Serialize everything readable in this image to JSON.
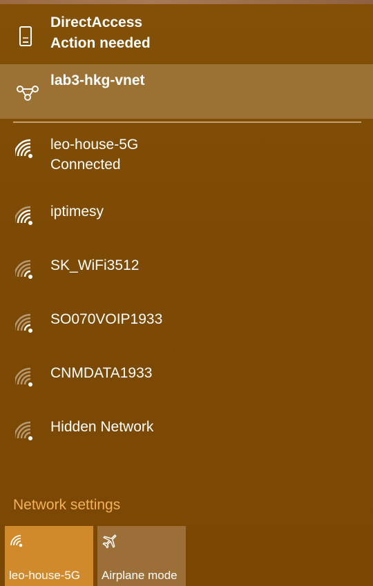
{
  "vpn": {
    "name": "DirectAccess",
    "status": "Action needed",
    "icon": "phone-vpn-icon"
  },
  "dial_up": {
    "name": "lab3-hkg-vnet",
    "icon": "vpn-connection-icon"
  },
  "networks": [
    {
      "name": "leo-house-5G",
      "status": "Connected",
      "icon": "wifi-signal-icon"
    },
    {
      "name": "iptimesy",
      "icon": "wifi-signal-icon"
    },
    {
      "name": "SK_WiFi3512",
      "icon": "wifi-signal-icon"
    },
    {
      "name": "SO070VOIP1933",
      "icon": "wifi-signal-icon"
    },
    {
      "name": "CNMDATA1933",
      "icon": "wifi-signal-icon"
    },
    {
      "name": "Hidden Network",
      "icon": "wifi-signal-icon"
    }
  ],
  "settings_link": "Network settings",
  "quick_actions": [
    {
      "label": "leo-house-5G",
      "icon": "wifi-icon",
      "active": true
    },
    {
      "label": "Airplane mode",
      "icon": "airplane-icon",
      "active": false
    }
  ],
  "colors": {
    "background": "#7f4b05",
    "accent": "#d18a2b",
    "link": "#f3b15a"
  }
}
